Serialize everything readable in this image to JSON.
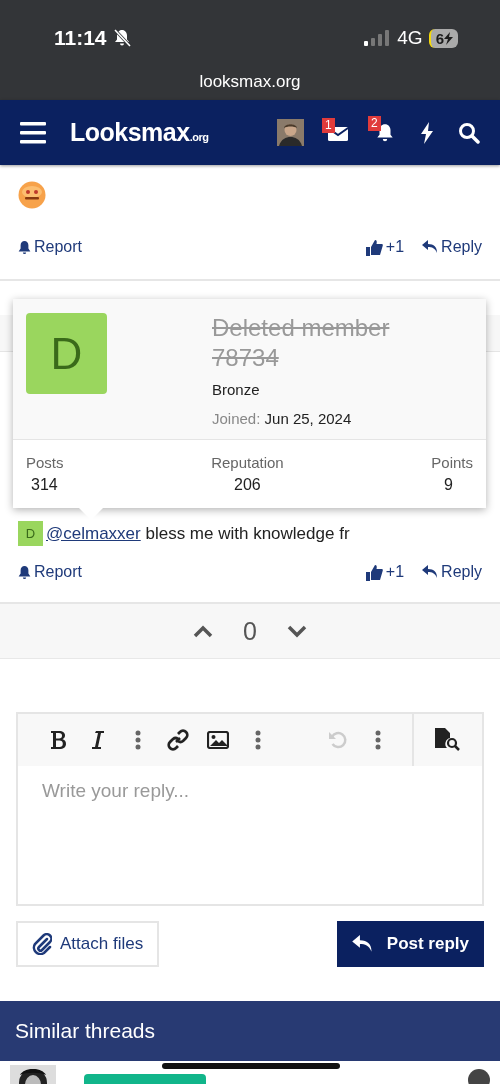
{
  "status_bar": {
    "time": "11:14",
    "network": "4G",
    "battery": "6"
  },
  "browser": {
    "url": "looksmax.org"
  },
  "nav": {
    "logo": "Looksmax",
    "logo_suffix": ".org",
    "messages_badge": "1",
    "alerts_badge": "2"
  },
  "posts": [
    {
      "report": "Report",
      "like": "+1",
      "reply": "Reply"
    },
    {
      "avatar_letter": "D",
      "mention": "@celmaxxer",
      "text": "bless me with knowledge fr",
      "report": "Report",
      "like": "+1",
      "reply": "Reply"
    }
  ],
  "member_card": {
    "avatar_letter": "D",
    "name": "Deleted member 78734",
    "deleted": true,
    "title": "Bronze",
    "joined_label": "Joined:",
    "joined": "Jun 25, 2024",
    "stats": [
      {
        "label": "Posts",
        "value": "314"
      },
      {
        "label": "Reputation",
        "value": "206"
      },
      {
        "label": "Points",
        "value": "9"
      }
    ]
  },
  "vote": {
    "score": "0"
  },
  "editor": {
    "placeholder": "Write your reply..."
  },
  "attach_button": "Attach files",
  "post_button": "Post reply",
  "similar": {
    "title": "Similar threads"
  }
}
